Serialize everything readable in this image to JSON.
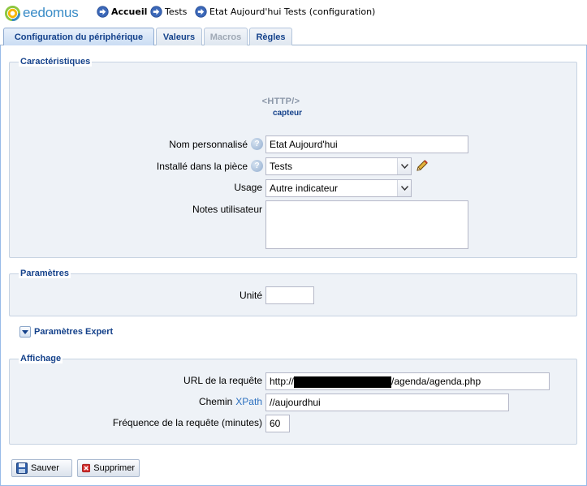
{
  "app": {
    "logo_text": "eedomus"
  },
  "breadcrumb": [
    {
      "label": "Accueil"
    },
    {
      "label": "Tests"
    },
    {
      "label": "Etat Aujourd'hui Tests (configuration)"
    }
  ],
  "tabs": [
    {
      "label": "Configuration du périphérique",
      "state": "active"
    },
    {
      "label": "Valeurs",
      "state": "normal"
    },
    {
      "label": "Macros",
      "state": "disabled"
    },
    {
      "label": "Règles",
      "state": "normal"
    }
  ],
  "caracteristiques": {
    "legend": "Caractéristiques",
    "device_icon_text": "<HTTP/>",
    "device_type": "capteur",
    "nom_label": "Nom personnalisé",
    "nom_value": "Etat Aujourd'hui",
    "piece_label": "Installé dans la pièce",
    "piece_value": "Tests",
    "usage_label": "Usage",
    "usage_value": "Autre indicateur",
    "notes_label": "Notes utilisateur",
    "notes_value": ""
  },
  "parametres": {
    "legend": "Paramètres",
    "unite_label": "Unité",
    "unite_value": ""
  },
  "expert": {
    "label": "Paramètres Expert"
  },
  "affichage": {
    "legend": "Affichage",
    "url_label": "URL de la requête",
    "url_prefix": "http://",
    "url_suffix": "/agenda/agenda.php",
    "chemin_label": "Chemin",
    "xpath_link": "XPath",
    "chemin_value": "//aujourdhui",
    "frequence_label": "Fréquence de la requête (minutes)",
    "frequence_value": "60"
  },
  "actions": {
    "save_label": "Sauver",
    "delete_label": "Supprimer"
  },
  "colors": {
    "accent": "#15428b",
    "panel_bg": "#eef2f7",
    "border": "#99bbe8"
  }
}
